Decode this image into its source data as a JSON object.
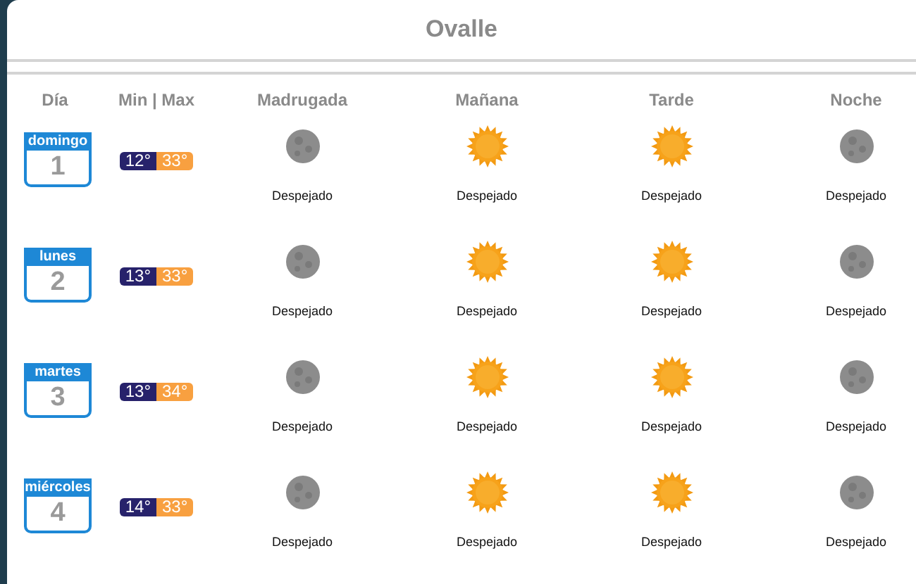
{
  "title": "Ovalle",
  "columns": [
    "Día",
    "Min | Max",
    "Madrugada",
    "Mañana",
    "Tarde",
    "Noche"
  ],
  "days": [
    {
      "weekday": "domingo",
      "date": "1",
      "min": "12°",
      "max": "33°",
      "periods": [
        {
          "kind": "moon",
          "label": "Despejado"
        },
        {
          "kind": "sun",
          "label": "Despejado"
        },
        {
          "kind": "sun",
          "label": "Despejado"
        },
        {
          "kind": "moon",
          "label": "Despejado"
        }
      ]
    },
    {
      "weekday": "lunes",
      "date": "2",
      "min": "13°",
      "max": "33°",
      "periods": [
        {
          "kind": "moon",
          "label": "Despejado"
        },
        {
          "kind": "sun",
          "label": "Despejado"
        },
        {
          "kind": "sun",
          "label": "Despejado"
        },
        {
          "kind": "moon",
          "label": "Despejado"
        }
      ]
    },
    {
      "weekday": "martes",
      "date": "3",
      "min": "13°",
      "max": "34°",
      "periods": [
        {
          "kind": "moon",
          "label": "Despejado"
        },
        {
          "kind": "sun",
          "label": "Despejado"
        },
        {
          "kind": "sun",
          "label": "Despejado"
        },
        {
          "kind": "moon",
          "label": "Despejado"
        }
      ]
    },
    {
      "weekday": "miércoles",
      "date": "4",
      "min": "14°",
      "max": "33°",
      "periods": [
        {
          "kind": "moon",
          "label": "Despejado"
        },
        {
          "kind": "sun",
          "label": "Despejado"
        },
        {
          "kind": "sun",
          "label": "Despejado"
        },
        {
          "kind": "moon",
          "label": "Despejado"
        }
      ]
    }
  ]
}
